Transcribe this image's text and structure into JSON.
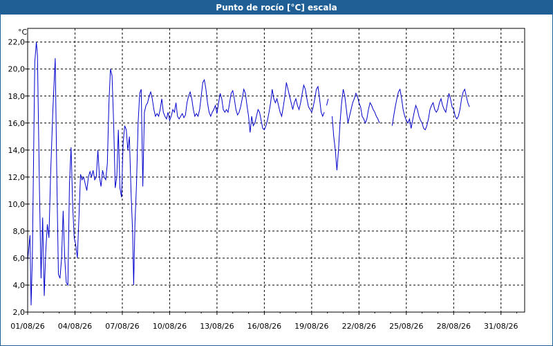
{
  "window": {
    "title": "Punto de rocío [°C] escala"
  },
  "chart_data": {
    "type": "line",
    "title": "Punto de rocío [°C] escala",
    "ylabel": "°C",
    "xlabel": "",
    "ylim": [
      2.0,
      22.0
    ],
    "xlim": [
      0,
      31.5
    ],
    "grid": true,
    "line_color": "#0000cc",
    "y_ticks": [
      "2,0",
      "4,0",
      "6,0",
      "8,0",
      "10,0",
      "12,0",
      "14,0",
      "16,0",
      "18,0",
      "20,0",
      "22,0"
    ],
    "x_ticks": [
      "01/08/26",
      "04/08/26",
      "07/08/26",
      "10/08/26",
      "13/08/26",
      "16/08/26",
      "19/08/26",
      "22/08/26",
      "25/08/26",
      "28/08/26",
      "31/08/26"
    ],
    "series": [
      {
        "segments": [
          [
            [
              0.0,
              5.8
            ],
            [
              0.15,
              7.7
            ],
            [
              0.22,
              2.5
            ],
            [
              0.3,
              6.0
            ],
            [
              0.45,
              20.5
            ],
            [
              0.55,
              22.0
            ],
            [
              0.62,
              21.0
            ],
            [
              0.75,
              11.0
            ],
            [
              0.85,
              4.5
            ],
            [
              0.95,
              9.0
            ],
            [
              1.05,
              3.2
            ],
            [
              1.15,
              6.5
            ],
            [
              1.25,
              8.5
            ],
            [
              1.35,
              7.5
            ],
            [
              1.45,
              12.0
            ],
            [
              1.6,
              17.0
            ],
            [
              1.75,
              20.8
            ],
            [
              1.85,
              12.0
            ],
            [
              1.95,
              4.8
            ],
            [
              2.05,
              4.5
            ],
            [
              2.15,
              6.0
            ],
            [
              2.25,
              9.5
            ],
            [
              2.35,
              6.0
            ],
            [
              2.45,
              4.2
            ],
            [
              2.55,
              4.0
            ],
            [
              2.65,
              11.5
            ],
            [
              2.75,
              14.2
            ],
            [
              2.85,
              10.0
            ],
            [
              2.95,
              7.5
            ],
            [
              3.05,
              7.0
            ],
            [
              3.15,
              6.0
            ],
            [
              3.25,
              9.0
            ],
            [
              3.35,
              12.2
            ],
            [
              3.45,
              11.8
            ],
            [
              3.55,
              12.0
            ],
            [
              3.65,
              11.5
            ],
            [
              3.75,
              11.0
            ],
            [
              3.85,
              12.0
            ],
            [
              3.95,
              12.4
            ],
            [
              4.05,
              12.0
            ],
            [
              4.15,
              12.5
            ],
            [
              4.25,
              11.8
            ],
            [
              4.35,
              12.0
            ],
            [
              4.45,
              14.0
            ],
            [
              4.55,
              12.0
            ],
            [
              4.65,
              11.3
            ],
            [
              4.75,
              12.5
            ],
            [
              4.85,
              12.0
            ],
            [
              4.95,
              11.8
            ],
            [
              5.05,
              13.0
            ],
            [
              5.15,
              17.5
            ],
            [
              5.25,
              20.0
            ],
            [
              5.35,
              19.5
            ],
            [
              5.45,
              16.0
            ],
            [
              5.55,
              11.2
            ],
            [
              5.65,
              12.0
            ],
            [
              5.75,
              15.5
            ],
            [
              5.85,
              11.2
            ],
            [
              5.95,
              10.5
            ],
            [
              6.05,
              14.5
            ],
            [
              6.15,
              15.8
            ],
            [
              6.25,
              15.5
            ],
            [
              6.35,
              14.0
            ],
            [
              6.45,
              15.0
            ],
            [
              6.55,
              11.0
            ],
            [
              6.65,
              8.0
            ],
            [
              6.72,
              4.0
            ],
            [
              6.8,
              8.5
            ],
            [
              6.9,
              11.5
            ],
            [
              7.0,
              16.0
            ],
            [
              7.1,
              18.2
            ],
            [
              7.2,
              18.5
            ],
            [
              7.3,
              11.3
            ],
            [
              7.4,
              16.8
            ],
            [
              7.5,
              17.3
            ],
            [
              7.6,
              17.5
            ],
            [
              7.7,
              18.0
            ],
            [
              7.8,
              18.3
            ],
            [
              7.9,
              17.8
            ],
            [
              8.0,
              17.0
            ],
            [
              8.1,
              16.5
            ],
            [
              8.2,
              16.7
            ],
            [
              8.3,
              16.5
            ],
            [
              8.4,
              17.0
            ],
            [
              8.5,
              17.8
            ],
            [
              8.6,
              16.8
            ],
            [
              8.7,
              16.5
            ],
            [
              8.8,
              16.3
            ],
            [
              8.9,
              16.8
            ],
            [
              9.0,
              16.2
            ],
            [
              9.1,
              16.5
            ],
            [
              9.2,
              17.0
            ],
            [
              9.3,
              16.8
            ],
            [
              9.4,
              17.5
            ],
            [
              9.5,
              16.5
            ],
            [
              9.6,
              16.3
            ],
            [
              9.7,
              16.5
            ],
            [
              9.8,
              16.7
            ],
            [
              9.9,
              16.4
            ],
            [
              10.0,
              16.6
            ],
            [
              10.1,
              17.5
            ],
            [
              10.2,
              18.0
            ],
            [
              10.3,
              18.3
            ],
            [
              10.4,
              17.8
            ],
            [
              10.5,
              17.0
            ],
            [
              10.6,
              16.5
            ],
            [
              10.7,
              16.7
            ],
            [
              10.8,
              16.5
            ],
            [
              10.9,
              17.0
            ],
            [
              11.0,
              18.0
            ],
            [
              11.1,
              19.0
            ],
            [
              11.2,
              19.2
            ],
            [
              11.3,
              18.5
            ],
            [
              11.4,
              17.5
            ],
            [
              11.5,
              16.8
            ],
            [
              11.6,
              16.5
            ],
            [
              11.7,
              16.8
            ],
            [
              11.8,
              17.0
            ],
            [
              11.9,
              17.3
            ],
            [
              12.0,
              16.7
            ],
            [
              12.1,
              17.5
            ],
            [
              12.2,
              18.2
            ],
            [
              12.3,
              17.8
            ],
            [
              12.4,
              17.0
            ],
            [
              12.5,
              16.8
            ],
            [
              12.6,
              17.0
            ],
            [
              12.7,
              16.8
            ],
            [
              12.8,
              17.5
            ],
            [
              12.9,
              18.2
            ],
            [
              13.0,
              18.4
            ],
            [
              13.1,
              17.8
            ],
            [
              13.2,
              17.0
            ],
            [
              13.3,
              16.6
            ],
            [
              13.4,
              16.8
            ],
            [
              13.5,
              17.2
            ],
            [
              13.6,
              17.8
            ],
            [
              13.7,
              18.5
            ],
            [
              13.8,
              18.2
            ],
            [
              13.9,
              17.3
            ],
            [
              14.0,
              16.5
            ],
            [
              14.1,
              15.3
            ],
            [
              14.2,
              16.5
            ],
            [
              14.3,
              15.8
            ],
            [
              14.4,
              16.0
            ],
            [
              14.5,
              16.5
            ],
            [
              14.6,
              17.0
            ],
            [
              14.7,
              16.8
            ],
            [
              14.8,
              16.2
            ],
            [
              14.9,
              15.6
            ],
            [
              15.0,
              15.5
            ],
            [
              15.1,
              15.8
            ],
            [
              15.2,
              16.2
            ],
            [
              15.3,
              16.8
            ],
            [
              15.4,
              17.5
            ],
            [
              15.5,
              18.5
            ],
            [
              15.6,
              17.8
            ],
            [
              15.7,
              17.5
            ],
            [
              15.8,
              17.8
            ],
            [
              15.9,
              17.3
            ],
            [
              16.0,
              16.8
            ],
            [
              16.1,
              16.5
            ],
            [
              16.2,
              17.2
            ],
            [
              16.3,
              18.0
            ],
            [
              16.4,
              19.0
            ],
            [
              16.5,
              18.5
            ],
            [
              16.6,
              18.0
            ],
            [
              16.7,
              17.5
            ],
            [
              16.8,
              17.0
            ],
            [
              16.9,
              17.5
            ],
            [
              17.0,
              17.8
            ],
            [
              17.1,
              17.3
            ],
            [
              17.2,
              17.0
            ],
            [
              17.3,
              17.5
            ],
            [
              17.4,
              18.2
            ],
            [
              17.5,
              18.8
            ],
            [
              17.6,
              18.5
            ],
            [
              17.7,
              17.8
            ],
            [
              17.8,
              17.2
            ],
            [
              17.9,
              17.0
            ],
            [
              18.0,
              16.8
            ],
            [
              18.1,
              17.2
            ],
            [
              18.2,
              17.8
            ],
            [
              18.3,
              18.5
            ],
            [
              18.4,
              18.7
            ],
            [
              18.5,
              17.8
            ],
            [
              18.6,
              16.8
            ],
            [
              18.7,
              16.5
            ],
            [
              18.8,
              16.8
            ]
          ],
          [
            [
              18.95,
              17.3
            ],
            [
              19.05,
              17.8
            ]
          ],
          [
            [
              19.3,
              16.5
            ],
            [
              19.4,
              15.0
            ],
            [
              19.5,
              14.0
            ],
            [
              19.6,
              12.5
            ],
            [
              19.7,
              14.0
            ],
            [
              19.8,
              16.0
            ],
            [
              19.9,
              17.5
            ],
            [
              20.0,
              18.5
            ],
            [
              20.1,
              18.0
            ],
            [
              20.2,
              17.0
            ],
            [
              20.3,
              16.0
            ],
            [
              20.4,
              16.5
            ],
            [
              20.5,
              17.0
            ],
            [
              20.6,
              17.5
            ],
            [
              20.7,
              17.8
            ],
            [
              20.8,
              18.2
            ],
            [
              20.9,
              18.0
            ],
            [
              21.0,
              17.5
            ],
            [
              21.1,
              17.2
            ],
            [
              21.2,
              16.5
            ],
            [
              21.3,
              16.3
            ],
            [
              21.4,
              16.0
            ],
            [
              21.5,
              16.3
            ],
            [
              21.6,
              17.0
            ],
            [
              21.7,
              17.5
            ],
            [
              21.8,
              17.3
            ],
            [
              21.9,
              17.0
            ],
            [
              22.0,
              16.8
            ],
            [
              22.1,
              16.5
            ],
            [
              22.2,
              16.3
            ],
            [
              22.3,
              16.0
            ]
          ],
          [
            [
              23.1,
              15.8
            ],
            [
              23.2,
              16.5
            ],
            [
              23.3,
              17.2
            ],
            [
              23.4,
              17.8
            ],
            [
              23.5,
              18.3
            ],
            [
              23.6,
              18.5
            ],
            [
              23.7,
              17.8
            ],
            [
              23.8,
              17.0
            ],
            [
              23.9,
              16.5
            ],
            [
              24.0,
              16.2
            ],
            [
              24.1,
              16.0
            ],
            [
              24.2,
              16.3
            ],
            [
              24.3,
              15.6
            ],
            [
              24.4,
              16.2
            ],
            [
              24.5,
              16.8
            ],
            [
              24.6,
              17.3
            ],
            [
              24.7,
              17.0
            ],
            [
              24.8,
              16.5
            ],
            [
              24.9,
              16.2
            ],
            [
              25.0,
              16.0
            ],
            [
              25.1,
              15.6
            ],
            [
              25.2,
              15.5
            ],
            [
              25.3,
              15.8
            ],
            [
              25.4,
              16.3
            ],
            [
              25.5,
              17.0
            ],
            [
              25.6,
              17.3
            ],
            [
              25.7,
              17.5
            ],
            [
              25.8,
              17.0
            ],
            [
              25.9,
              16.8
            ],
            [
              26.0,
              17.0
            ],
            [
              26.1,
              17.5
            ],
            [
              26.2,
              17.8
            ],
            [
              26.3,
              17.3
            ],
            [
              26.4,
              17.0
            ],
            [
              26.5,
              16.8
            ],
            [
              26.6,
              17.5
            ],
            [
              26.7,
              18.2
            ],
            [
              26.8,
              17.8
            ],
            [
              26.9,
              17.2
            ],
            [
              27.0,
              17.0
            ],
            [
              27.1,
              16.5
            ],
            [
              27.2,
              16.3
            ],
            [
              27.3,
              16.5
            ],
            [
              27.4,
              17.0
            ],
            [
              27.5,
              17.8
            ],
            [
              27.6,
              18.3
            ],
            [
              27.7,
              18.5
            ],
            [
              27.8,
              18.0
            ],
            [
              27.9,
              17.5
            ],
            [
              28.0,
              17.2
            ]
          ]
        ]
      }
    ]
  }
}
